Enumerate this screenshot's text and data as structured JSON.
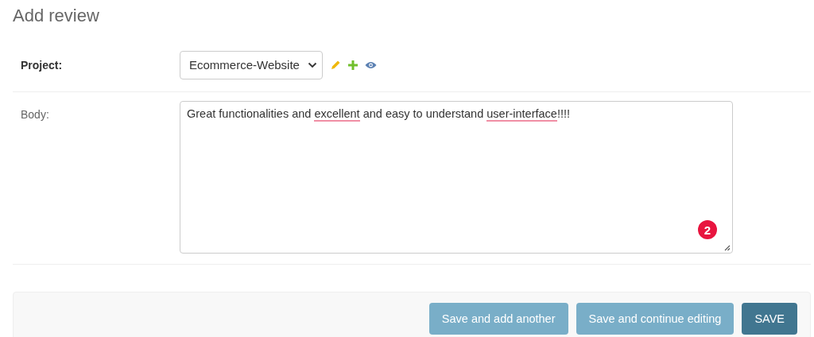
{
  "title": "Add review",
  "project": {
    "label": "Project:",
    "value": "Ecommerce-Website"
  },
  "body": {
    "label": "Body:",
    "segments": [
      {
        "text": "Great functionalities and ",
        "misspelled": false
      },
      {
        "text": "excellent",
        "misspelled": true
      },
      {
        "text": " and easy to understand ",
        "misspelled": false
      },
      {
        "text": "user-interface",
        "misspelled": true
      },
      {
        "text": "!!!!",
        "misspelled": false
      }
    ],
    "badge": "2"
  },
  "buttons": [
    {
      "label": "Save and add another",
      "kind": "secondary"
    },
    {
      "label": "Save and continue editing",
      "kind": "secondary"
    },
    {
      "label": "SAVE",
      "kind": "default"
    }
  ]
}
